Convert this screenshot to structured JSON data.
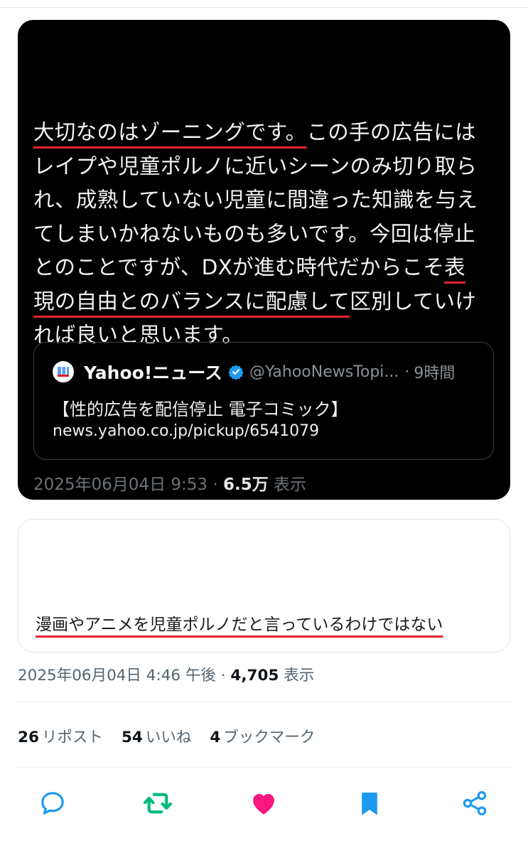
{
  "embedded_post": {
    "lines": [
      {
        "underlined": "大切なのはゾーニングです。",
        "after": "この手の広告には"
      },
      {
        "text": "レイプや児童ポルノに近いシーンのみ切り取ら"
      },
      {
        "text": "れ、成熟していない児童に間違った知識を与え"
      },
      {
        "text": "てしまいかねないものも多いです。今回は停止"
      },
      {
        "before": "とのことですが、DXが進む時代だからこそ",
        "underlined": "表"
      },
      {
        "underlined": "現の自由とのバランスに配慮して",
        "after": "区別していけ"
      },
      {
        "text": "れば良いと思います。"
      }
    ],
    "quote": {
      "name": "Yahoo!ニュース",
      "handle": "@YahooNewsTopi...",
      "separator": "·",
      "time": "9時間",
      "title": "【性的広告を配信停止 電子コミック】",
      "url": "news.yahoo.co.jp/pickup/6541079"
    },
    "meta": {
      "datetime": "2025年06月04日 9:53",
      "separator": "·",
      "views": "6.5万",
      "views_label": "表示"
    }
  },
  "quoted_card": {
    "text": "漫画やアニメを児童ポルノだと言っているわけではない"
  },
  "post_meta": {
    "datetime": "2025年06月04日 4:46 午後",
    "separator": "·",
    "views": "4,705",
    "views_label": "表示"
  },
  "stats": [
    {
      "count": "26",
      "label": "リポスト"
    },
    {
      "count": "54",
      "label": "いいね"
    },
    {
      "count": "4",
      "label": "ブックマーク"
    }
  ],
  "actions": [
    {
      "name": "reply",
      "icon": "reply-icon",
      "color": "#1d9bf0"
    },
    {
      "name": "repost",
      "icon": "repost-icon",
      "color": "#00ba7c"
    },
    {
      "name": "like",
      "icon": "heart-icon",
      "color": "#f91880"
    },
    {
      "name": "bookmark",
      "icon": "bookmark-icon",
      "color": "#1d9bf0"
    },
    {
      "name": "share",
      "icon": "share-icon",
      "color": "#1d9bf0"
    }
  ],
  "colors": {
    "underline": "#e0262e",
    "verified": "#1d9bf0"
  }
}
